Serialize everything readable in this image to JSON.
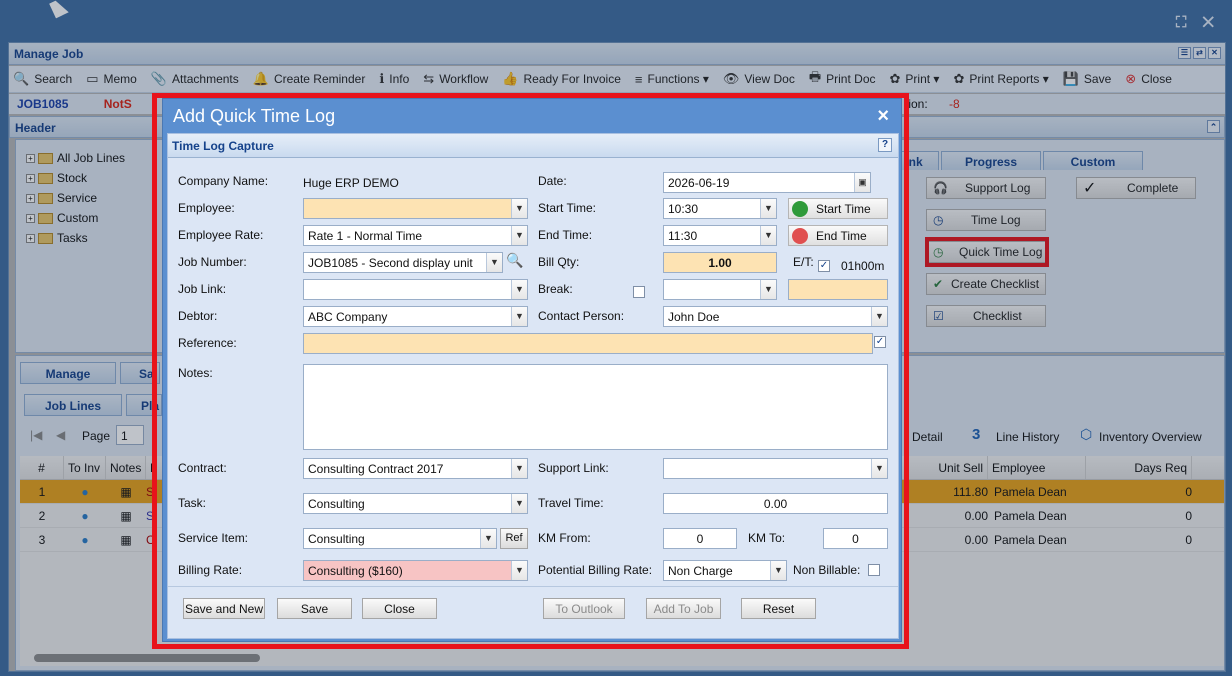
{
  "window": {
    "buttons": "⛶ ✕"
  },
  "manage_job": {
    "title": "Manage Job",
    "title_tools": [
      "☰",
      "⇄",
      "✕"
    ]
  },
  "toolbar": {
    "items": [
      {
        "icon": "search-icon",
        "glyph": "🔍",
        "label": "Search"
      },
      {
        "icon": "memo-icon",
        "glyph": "▭",
        "label": "Memo"
      },
      {
        "icon": "paperclip-icon",
        "glyph": "📎",
        "label": "Attachments"
      },
      {
        "icon": "bell-icon",
        "glyph": "🔔",
        "label": "Create Reminder"
      },
      {
        "icon": "info-icon",
        "glyph": "ℹ",
        "label": "Info"
      },
      {
        "icon": "workflow-icon",
        "glyph": "⇆",
        "label": "Workflow"
      },
      {
        "icon": "thumbs-up-icon",
        "glyph": "👍",
        "label": "Ready For Invoice"
      },
      {
        "icon": "functions-icon",
        "glyph": "≡",
        "label": "Functions ▾"
      },
      {
        "icon": "eye-icon",
        "glyph": "👁",
        "label": "View Doc"
      },
      {
        "icon": "printer-icon",
        "glyph": "🖶",
        "label": "Print Doc"
      },
      {
        "icon": "print-icon",
        "glyph": "✿",
        "label": "Print ▾"
      },
      {
        "icon": "print-reports-icon",
        "glyph": "✿",
        "label": "Print Reports ▾"
      },
      {
        "icon": "save-icon",
        "glyph": "💾",
        "label": "Save"
      },
      {
        "icon": "close-icon",
        "glyph": "⊗",
        "label": "Close"
      }
    ]
  },
  "jobrow": {
    "job": "JOB1085",
    "status": "NotS",
    "right_label": "tion:",
    "right_value": "-8"
  },
  "header": {
    "title": "Header",
    "collapse": "⌃"
  },
  "tree": [
    "All Job Lines",
    "Stock",
    "Service",
    "Custom",
    "Tasks"
  ],
  "right_tabs": [
    "ink",
    "Progress",
    "Custom"
  ],
  "side_buttons": [
    {
      "icon": "headset-icon",
      "glyph": "🎧",
      "label": "Support Log"
    },
    {
      "icon": "clock-icon",
      "glyph": "◷",
      "label": "Time Log"
    },
    {
      "icon": "quick-clock-icon",
      "glyph": "◷",
      "label": "Quick Time Log"
    },
    {
      "icon": "clipboard-check-icon",
      "glyph": "✔",
      "label": "Create Checklist"
    },
    {
      "icon": "checklist-icon",
      "glyph": "☑",
      "label": "Checklist"
    }
  ],
  "complete_button": {
    "icon": "✓",
    "label": "Complete"
  },
  "bottom_tabs": {
    "manage": "Manage",
    "sa": "Sa",
    "job_lines": "Job Lines",
    "pla": "Pla"
  },
  "pager": {
    "first": "|◀",
    "prev": "◀",
    "label": "Page",
    "value": "1"
  },
  "grid_tools": {
    "detail": "Detail",
    "count": "3",
    "line_history": "Line History",
    "inventory": "Inventory Overview"
  },
  "grid": {
    "headers": [
      "#",
      "To Inv",
      "Notes",
      "L",
      "Unit Sell",
      "Employee",
      "Days Req"
    ],
    "rows": [
      {
        "n": "1",
        "sell": "111.80",
        "emp": "Pamela Dean",
        "days": "0",
        "l": "S"
      },
      {
        "n": "2",
        "sell": "0.00",
        "emp": "Pamela Dean",
        "days": "0",
        "l": "S"
      },
      {
        "n": "3",
        "sell": "0.00",
        "emp": "Pamela Dean",
        "days": "0",
        "l": "C"
      }
    ]
  },
  "dialog": {
    "title": "Add Quick Time Log",
    "close": "×",
    "section": "Time Log Capture",
    "help": "?",
    "labels": {
      "company": "Company Name:",
      "date": "Date:",
      "employee": "Employee:",
      "start_time": "Start Time:",
      "employee_rate": "Employee Rate:",
      "end_time": "End Time:",
      "job_number": "Job Number:",
      "bill_qty": "Bill Qty:",
      "et": "E/T:",
      "job_link": "Job Link:",
      "break": "Break:",
      "debtor": "Debtor:",
      "contact": "Contact Person:",
      "reference": "Reference:",
      "notes": "Notes:",
      "contract": "Contract:",
      "support_link": "Support Link:",
      "task": "Task:",
      "travel_time": "Travel Time:",
      "service_item": "Service Item:",
      "km_from": "KM From:",
      "km_to": "KM To:",
      "billing_rate": "Billing Rate:",
      "potential_rate": "Potential Billing Rate:",
      "non_billable": "Non Billable:"
    },
    "values": {
      "company": "Huge ERP DEMO",
      "date": "2026-06-19",
      "employee": "",
      "start_time": "10:30",
      "employee_rate": "Rate 1 - Normal Time",
      "end_time": "11:30",
      "job_number": "JOB1085 - Second display unit",
      "bill_qty": "1.00",
      "et_duration": "01h00m",
      "job_link": "",
      "break": "",
      "debtor": "ABC Company",
      "contact": "John Doe",
      "reference": "",
      "notes": "",
      "contract": "Consulting Contract 2017",
      "support_link": "",
      "task": "Consulting",
      "travel_time": "0.00",
      "service_item": "Consulting",
      "km_from": "0",
      "km_to": "0",
      "billing_rate": "Consulting ($160)",
      "potential_rate": "Non Charge"
    },
    "checks": {
      "et": "✓",
      "reference": "✓",
      "break": "",
      "non_billable": ""
    },
    "start_time_button": "Start Time",
    "end_time_button": "End Time",
    "ref_button": "Ref",
    "buttons": {
      "save_new": "Save and New",
      "save": "Save",
      "close": "Close",
      "to_outlook": "To Outlook",
      "add_to_job": "Add To Job",
      "reset": "Reset"
    }
  }
}
